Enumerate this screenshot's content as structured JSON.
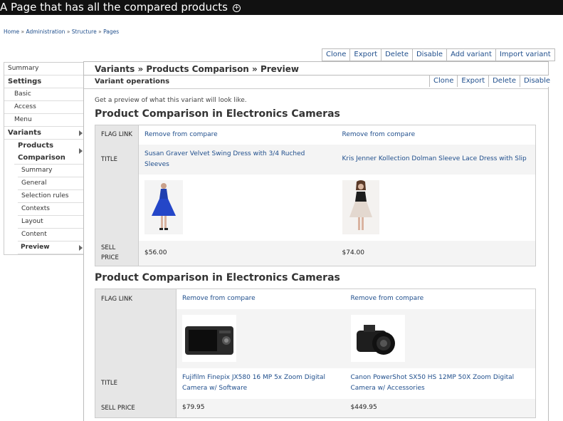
{
  "page": {
    "title": "A Page that has all the compared products",
    "breadcrumb": [
      "Home",
      "Administration",
      "Structure",
      "Pages"
    ]
  },
  "top_actions": [
    "Clone",
    "Export",
    "Delete",
    "Disable",
    "Add variant",
    "Import variant"
  ],
  "panel": {
    "title": "Variants » Products Comparison » Preview",
    "operations_label": "Variant operations",
    "operations": [
      "Clone",
      "Export",
      "Delete",
      "Disable"
    ],
    "description": "Get a preview of what this variant will look like."
  },
  "nav": {
    "summary": "Summary",
    "settings": "Settings",
    "basic": "Basic",
    "access": "Access",
    "menu": "Menu",
    "variants": "Variants",
    "products_comparison_1": "Products",
    "products_comparison_2": "Comparison",
    "sub_summary": "Summary",
    "general": "General",
    "selection_rules": "Selection rules",
    "contexts": "Contexts",
    "layout": "Layout",
    "content": "Content",
    "preview": "Preview"
  },
  "sections": [
    {
      "title": "Product Comparison in Electronics Cameras",
      "labels": {
        "flag": "FLAG LINK",
        "title": "TITLE",
        "price_1": "SELL",
        "price_2": "PRICE"
      },
      "products": [
        {
          "flag": "Remove from compare",
          "title": "Susan Graver Velvet Swing Dress with 3/4 Ruched Sleeves",
          "price": "$56.00",
          "image": "blue-dress-icon"
        },
        {
          "flag": "Remove from compare",
          "title": "Kris Jenner Kollection Dolman Sleeve Lace Dress with Slip",
          "price": "$74.00",
          "image": "lace-dress-icon"
        }
      ]
    },
    {
      "title": "Product Comparison in Electronics Cameras",
      "labels": {
        "flag": "FLAG LINK",
        "title": "TITLE",
        "price": "SELL PRICE"
      },
      "products": [
        {
          "flag": "Remove from compare",
          "title": "Fujifilm Finepix JX580 16 MP 5x Zoom Digital Camera w/ Software",
          "price": "$79.95",
          "image": "compact-camera-icon"
        },
        {
          "flag": "Remove from compare",
          "title": "Canon PowerShot SX50 HS 12MP 50X Zoom Digital Camera w/ Accessories",
          "price": "$449.95",
          "image": "dslr-camera-icon"
        }
      ]
    }
  ]
}
